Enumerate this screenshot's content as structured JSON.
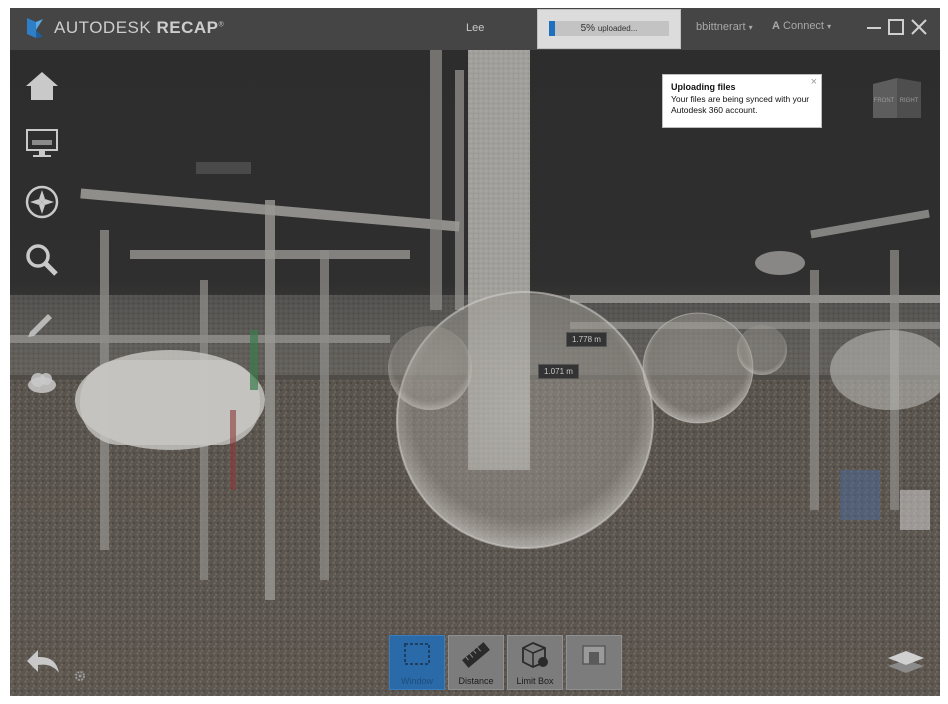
{
  "app": {
    "brand": "AUTODESK",
    "product": "RECAP",
    "trademark": "®"
  },
  "titlebar": {
    "user": "Lee",
    "account": "bbittnerart",
    "connect": "Connect"
  },
  "upload": {
    "percent_label": "5%",
    "suffix": "uploaded...",
    "progress_fraction": 0.05,
    "accent": "#1f6fbf"
  },
  "notification": {
    "title": "Uploading files",
    "body": "Your files are being synced with your Autodesk 360 account.",
    "close_glyph": "×"
  },
  "navigation": {
    "icons": [
      "home-icon",
      "display-icon",
      "compass-icon",
      "search-icon",
      "pencil-icon",
      "cloud-icon"
    ]
  },
  "measurements": {
    "first": "1.778 m",
    "second": "1.071 m"
  },
  "toolbar": {
    "tools": [
      {
        "label": "Window",
        "icon": "window-select-icon",
        "active": true
      },
      {
        "label": "Distance",
        "icon": "ruler-icon",
        "active": false
      },
      {
        "label": "Limit Box",
        "icon": "limit-box-icon",
        "active": false
      },
      {
        "label": "",
        "icon": "clip-icon",
        "active": false
      }
    ]
  },
  "colors": {
    "titlebar": "#454545",
    "active_tool": "#2a6aa8",
    "tool": "#7c7c7c"
  }
}
